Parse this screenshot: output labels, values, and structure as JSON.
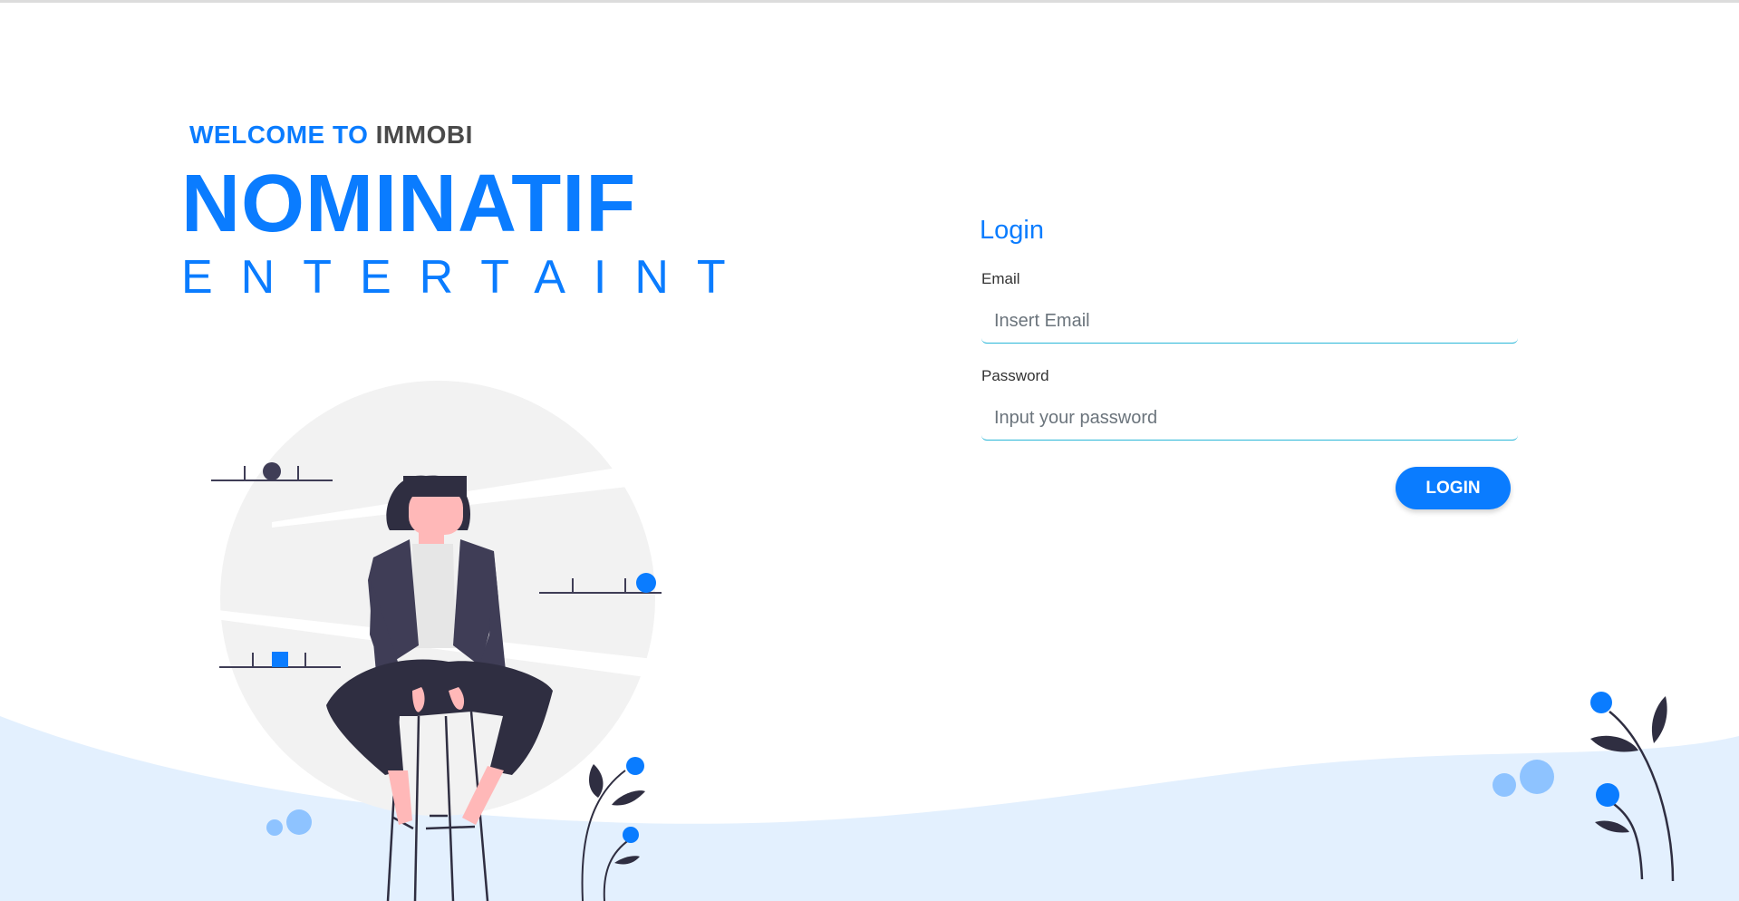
{
  "hero": {
    "welcome_prefix": "WELCOME TO",
    "welcome_brand": "IMMOBI",
    "brand_main": "NOMINATIF",
    "brand_sub": "ENTERTAINT"
  },
  "login": {
    "title": "Login",
    "email_label": "Email",
    "email_placeholder": "Insert Email",
    "email_value": "",
    "password_label": "Password",
    "password_placeholder": "Input your password",
    "password_value": "",
    "button_label": "LOGIN"
  },
  "colors": {
    "accent": "#0a7cff",
    "input_border": "#29b6d8",
    "wave": "#e3f0fe",
    "figure_dark": "#2f2e41",
    "skin": "#ffb8b8"
  },
  "icons": [
    "woman-sitting-illustration",
    "plant-illustration",
    "shelf-illustration"
  ]
}
